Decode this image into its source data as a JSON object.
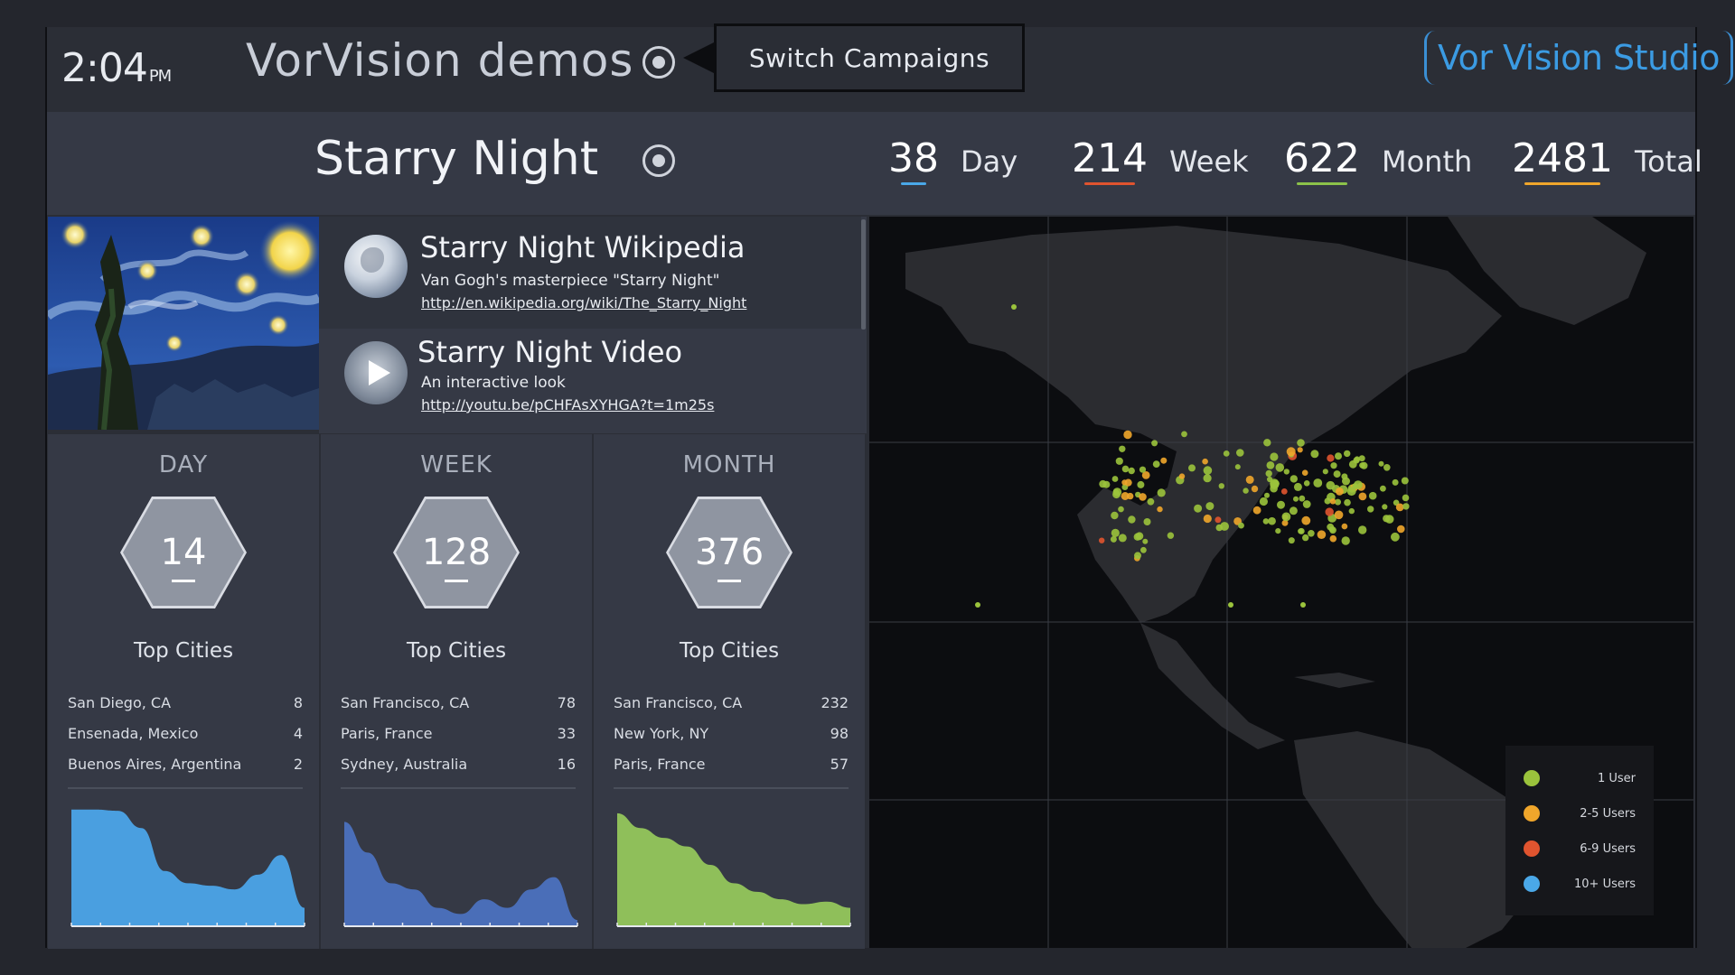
{
  "clock": {
    "time": "2:04",
    "ampm": "PM"
  },
  "app_title": "VorVision demos",
  "switch_campaigns_label": "Switch Campaigns",
  "brand": "Vor Vision Studio",
  "campaign": {
    "title": "Starry Night",
    "stats": [
      {
        "value": "38",
        "label": "Day",
        "underline": "#4aa8e8"
      },
      {
        "value": "214",
        "label": "Week",
        "underline": "#e0542f"
      },
      {
        "value": "622",
        "label": "Month",
        "underline": "#8cc24a"
      },
      {
        "value": "2481",
        "label": "Total",
        "underline": "#f0a62b"
      }
    ]
  },
  "links": [
    {
      "title": "Starry Night Wikipedia",
      "description": "Van Gogh's masterpiece \"Starry Night\"",
      "url": "http://en.wikipedia.org/wiki/The_Starry_Night",
      "icon": "globe-icon"
    },
    {
      "title": "Starry Night Video",
      "description": "An interactive look",
      "url": "http://youtu.be/pCHFAsXYHGA?t=1m25s",
      "icon": "play-icon"
    }
  ],
  "periods": [
    {
      "name": "DAY",
      "count": "14",
      "top_cities_label": "Top Cities",
      "cities": [
        {
          "city": "San Diego, CA",
          "n": "8"
        },
        {
          "city": "Ensenada, Mexico",
          "n": "4"
        },
        {
          "city": "Buenos Aires, Argentina",
          "n": "2"
        }
      ],
      "chart_color": "#4a9fe0",
      "trend": [
        0.95,
        0.95,
        0.94,
        0.8,
        0.45,
        0.35,
        0.33,
        0.3,
        0.42,
        0.58,
        0.15
      ]
    },
    {
      "name": "WEEK",
      "count": "128",
      "top_cities_label": "Top Cities",
      "cities": [
        {
          "city": "San Francisco, CA",
          "n": "78"
        },
        {
          "city": "Paris, France",
          "n": "33"
        },
        {
          "city": "Sydney, Australia",
          "n": "16"
        }
      ],
      "chart_color": "#4a6eb8",
      "trend": [
        0.85,
        0.6,
        0.35,
        0.3,
        0.15,
        0.1,
        0.22,
        0.15,
        0.3,
        0.4,
        0.05
      ]
    },
    {
      "name": "MONTH",
      "count": "376",
      "top_cities_label": "Top Cities",
      "cities": [
        {
          "city": "San Francisco, CA",
          "n": "232"
        },
        {
          "city": "New York, NY",
          "n": "98"
        },
        {
          "city": "Paris, France",
          "n": "57"
        }
      ],
      "chart_color": "#8fbf5a",
      "trend": [
        0.92,
        0.8,
        0.72,
        0.65,
        0.5,
        0.35,
        0.28,
        0.22,
        0.18,
        0.2,
        0.15
      ]
    }
  ],
  "map_legend": [
    {
      "label": "1 User",
      "color": "#9bc33c"
    },
    {
      "label": "2-5 Users",
      "color": "#f0a62b"
    },
    {
      "label": "6-9 Users",
      "color": "#e0542f"
    },
    {
      "label": "10+ Users",
      "color": "#4aa8e8"
    }
  ]
}
